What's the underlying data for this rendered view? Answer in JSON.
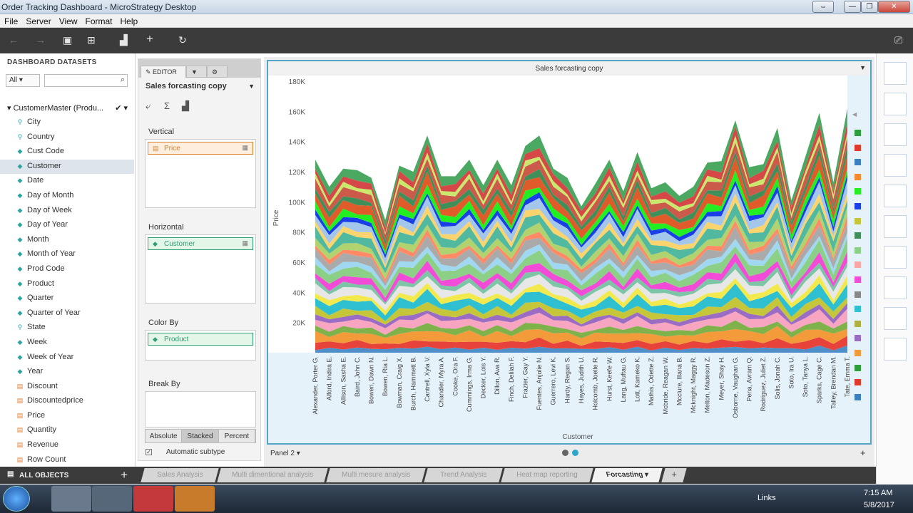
{
  "window": {
    "title": "Order Tracking Dashboard - MicroStrategy Desktop",
    "min": "—",
    "restore": "❐",
    "close": "✕",
    "swap": "⇔"
  },
  "menu": [
    "File",
    "Server",
    "View",
    "Format",
    "Help"
  ],
  "toolbar": {
    "undo": "←",
    "redo": "→",
    "save": "▣",
    "add_data": "⊞",
    "add_viz": "▟",
    "add": "+",
    "refresh": "↻",
    "present": "⎚"
  },
  "left_panel": {
    "header": "DASHBOARD DATASETS",
    "filter": "All",
    "dataset": "CustomerMaster (Produ...",
    "items": [
      {
        "label": "City",
        "type": "geo"
      },
      {
        "label": "Country",
        "type": "geo"
      },
      {
        "label": "Cust Code",
        "type": "attr"
      },
      {
        "label": "Customer",
        "type": "attr",
        "active": true
      },
      {
        "label": "Date",
        "type": "attr"
      },
      {
        "label": "Day of Month",
        "type": "attr"
      },
      {
        "label": "Day of Week",
        "type": "attr"
      },
      {
        "label": "Day of Year",
        "type": "attr"
      },
      {
        "label": "Month",
        "type": "attr"
      },
      {
        "label": "Month of Year",
        "type": "attr"
      },
      {
        "label": "Prod Code",
        "type": "attr"
      },
      {
        "label": "Product",
        "type": "attr"
      },
      {
        "label": "Quarter",
        "type": "attr"
      },
      {
        "label": "Quarter of Year",
        "type": "attr"
      },
      {
        "label": "State",
        "type": "geo"
      },
      {
        "label": "Week",
        "type": "attr"
      },
      {
        "label": "Week of Year",
        "type": "attr"
      },
      {
        "label": "Year",
        "type": "attr"
      },
      {
        "label": "Discount",
        "type": "metric"
      },
      {
        "label": "Discountedprice",
        "type": "metric"
      },
      {
        "label": "Price",
        "type": "metric"
      },
      {
        "label": "Quantity",
        "type": "metric"
      },
      {
        "label": "Revenue",
        "type": "metric"
      },
      {
        "label": "Row Count",
        "type": "metric"
      }
    ],
    "all_objects": "ALL OBJECTS"
  },
  "editor": {
    "tab_editor": "EDITOR",
    "viz_name": "Sales forcasting copy",
    "vertical": "Vertical",
    "vertical_item": "Price",
    "horizontal": "Horizontal",
    "horizontal_item": "Customer",
    "color_by": "Color By",
    "color_item": "Product",
    "break_by": "Break By",
    "modes": [
      "Absolute",
      "Stacked",
      "Percent"
    ],
    "active_mode": "Stacked",
    "auto_subtype": "Automatic subtype"
  },
  "viz": {
    "title": "Sales forcasting copy",
    "panel": "Panel 2"
  },
  "chart_data": {
    "type": "area",
    "stacked": true,
    "ylabel": "Price",
    "xlabel": "Customer",
    "ylim": [
      0,
      180000
    ],
    "y_ticks": [
      "20K",
      "40K",
      "60K",
      "80K",
      "100K",
      "120K",
      "140K",
      "160K",
      "180K"
    ],
    "categories": [
      "Alexander, Porter G.",
      "Alford, Indira E.",
      "Allison, Sasha E.",
      "Baird, John C.",
      "Bowen, Dawn N.",
      "Bowen, Ria L.",
      "Bowman, Craig X.",
      "Burch, Hammett B.",
      "Cantrell, Xyla V.",
      "Chandler, Myra A.",
      "Cooke, Ora F.",
      "Cummings, Irma G.",
      "Decker, Lois Y.",
      "Dillon, Ava R.",
      "Finch, Delilah F.",
      "Frazier, Gay Y.",
      "Fuentes, Anjolie N.",
      "Guerrero, Levi K.",
      "Hardy, Regan S.",
      "Hayes, Judith U.",
      "Holcomb, Joelle R.",
      "Hurst, Keefe W.",
      "Lang, Muftau G.",
      "Lott, Kameko K.",
      "Mathis, Odette Z.",
      "Mcbride, Reagan W.",
      "Mcclure, Illana B.",
      "Mcknight, Maggy R.",
      "Melton, Madeson Z.",
      "Meyer, Shay H.",
      "Osborne, Vaughan G.",
      "Pena, Avram Q.",
      "Rodriguez, Juliet Z.",
      "Solis, Jonah C.",
      "Soto, Ira U.",
      "Soto, Tanya L.",
      "Sparks, Cage C.",
      "Talley, Brendan M.",
      "Tate, Emma T."
    ],
    "totals": [
      128000,
      110000,
      122000,
      121000,
      116000,
      88000,
      124000,
      120000,
      144000,
      117000,
      117000,
      128000,
      111000,
      128000,
      111000,
      137000,
      144000,
      122000,
      116000,
      97000,
      112000,
      128000,
      107000,
      133000,
      109000,
      113000,
      104000,
      110000,
      126000,
      127000,
      154000,
      123000,
      125000,
      149000,
      101000,
      130000,
      159000,
      113000,
      162000
    ],
    "series_colors": [
      "#4f8fc9",
      "#e8433a",
      "#f39a3a",
      "#7fb24a",
      "#f7a5c0",
      "#9b6cc4",
      "#c6c63a",
      "#2ec0d0",
      "#f2e94f",
      "#e7e7e7",
      "#7dc5a6",
      "#f24bd8",
      "#8ccf87",
      "#9fd8f0",
      "#aaaaaa",
      "#ff8a65",
      "#b0d36f",
      "#50b9a0",
      "#fbd46e",
      "#a3c7ea",
      "#1a3ee8",
      "#22ee22",
      "#e05b2a",
      "#3f8f5a",
      "#cc5a4a",
      "#c9e86c",
      "#d64848",
      "#4aa860"
    ],
    "legend_colors": [
      "#2e9e3a",
      "#e03a2a",
      "#3a7fc0",
      "#f28a30",
      "#22ee22",
      "#1a3ee8",
      "#c6c63a",
      "#3f8f5a",
      "#8ccf87",
      "#f7a5a5",
      "#f24bd8",
      "#888888",
      "#2ec0d0",
      "#b0b040",
      "#9b6cc4",
      "#f39a3a",
      "#2e9e3a",
      "#e03a2a",
      "#3a7fc0"
    ]
  },
  "sheets": [
    "Sales Analysis",
    "Multi dimentional analysis",
    "Multi mesure analysis",
    "Trend Analysis",
    "Heat map reporting",
    "Forcasting"
  ],
  "active_sheet": "Forcasting",
  "taskbar": {
    "links": "Links",
    "time": "7:15 AM",
    "date": "5/8/2017"
  }
}
